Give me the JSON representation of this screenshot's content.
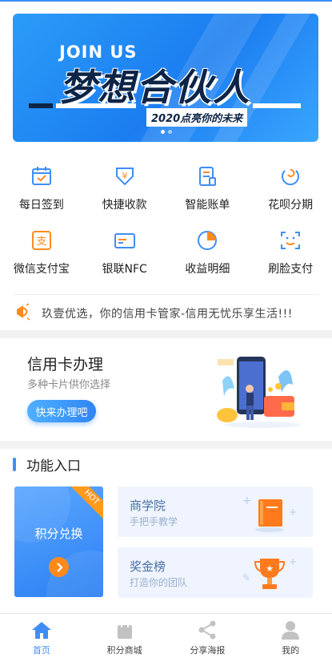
{
  "banner": {
    "headline": "JOIN US",
    "title": "梦想合伙人",
    "slogan": "2020点亮你的未来"
  },
  "grid": {
    "items": [
      {
        "label": "每日签到",
        "icon": "calendar-check-icon"
      },
      {
        "label": "快捷收款",
        "icon": "yen-receive-icon"
      },
      {
        "label": "智能账单",
        "icon": "bill-icon"
      },
      {
        "label": "花呗分期",
        "icon": "installment-icon"
      },
      {
        "label": "微信支付宝",
        "icon": "alipay-icon"
      },
      {
        "label": "银联NFC",
        "icon": "unionpay-card-icon"
      },
      {
        "label": "收益明细",
        "icon": "pie-chart-icon"
      },
      {
        "label": "刷脸支付",
        "icon": "face-scan-icon"
      }
    ]
  },
  "notice": {
    "text": "玖壹优选，你的信用卡管家-信用无忧乐享生活!!!"
  },
  "card": {
    "title": "信用卡办理",
    "subtitle": "多种卡片供你选择",
    "button": "快来办理吧"
  },
  "functions": {
    "title": "功能入口",
    "points": {
      "label": "积分兑换",
      "badge": "HOT"
    },
    "school": {
      "label": "商学院",
      "desc": "手把手教学"
    },
    "ranking": {
      "label": "奖金榜",
      "desc": "打造你的团队"
    }
  },
  "tabbar": {
    "items": [
      {
        "label": "首页",
        "icon": "home-icon",
        "active": true
      },
      {
        "label": "积分商城",
        "icon": "shopping-bag-icon",
        "active": false
      },
      {
        "label": "分享海报",
        "icon": "share-icon",
        "active": false
      },
      {
        "label": "我的",
        "icon": "user-icon",
        "active": false
      }
    ]
  },
  "colors": {
    "primary": "#3f8ef5",
    "orange": "#ff8a1c",
    "tile_bg": "#eff4fe"
  }
}
